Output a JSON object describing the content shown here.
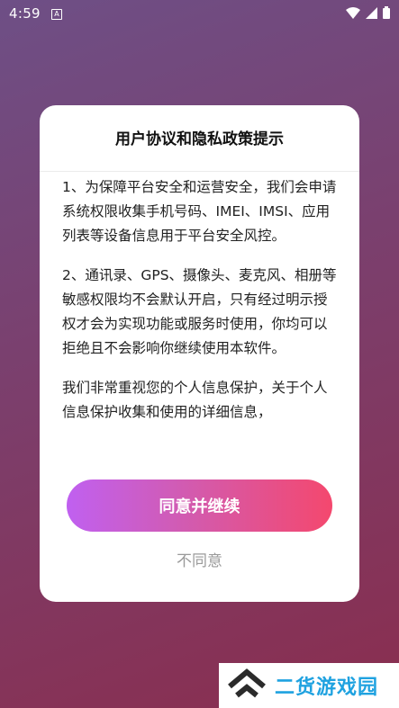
{
  "status_bar": {
    "time": "4:59",
    "a_icon_label": "A",
    "icons": [
      "wifi-icon",
      "signal-icon",
      "battery-icon"
    ]
  },
  "dialog": {
    "title": "用户协议和隐私政策提示",
    "paragraphs": [
      "1、为保障平台安全和运营安全，我们会申请系统权限收集手机号码、IMEI、IMSI、应用列表等设备信息用于平台安全风控。",
      "2、通讯录、GPS、摄像头、麦克风、相册等敏感权限均不会默认开启，只有经过明示授权才会为实现功能或服务时使用，你均可以拒绝且不会影响你继续使用本软件。",
      "我们非常重视您的个人信息保护，关于个人信息保护收集和使用的详细信息，"
    ],
    "agree_label": "同意并继续",
    "disagree_label": "不同意"
  },
  "watermark": {
    "text": "二货游戏园"
  },
  "colors": {
    "button_gradient_start": "#c060f0",
    "button_gradient_end": "#f4486e",
    "watermark_text": "#1fa2e0"
  }
}
